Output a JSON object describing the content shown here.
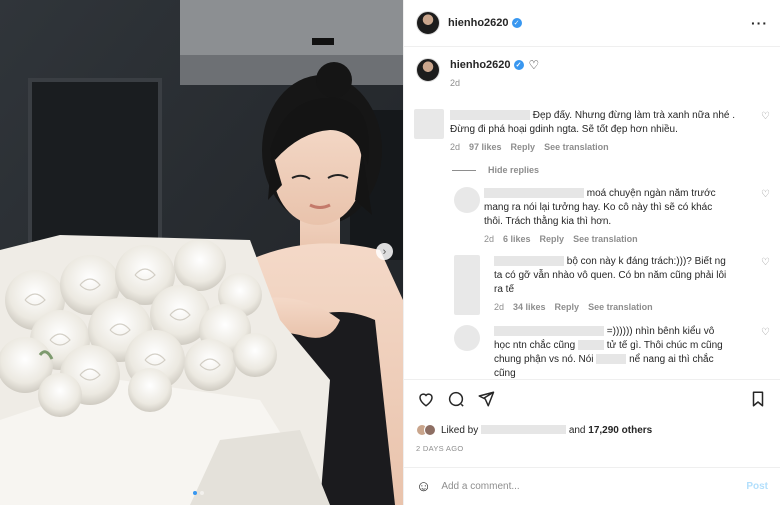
{
  "post": {
    "username": "hienho2620",
    "verified_icon": "verified-badge-icon",
    "more_icon": "more-options-icon"
  },
  "caption": {
    "username": "hienho2620",
    "time": "2d"
  },
  "comments": [
    {
      "text": "Đẹp đấy. Nhưng đừng làm trà xanh nữa nhé . Đừng đi phá hoại gdinh ngta. Sẽ tốt đẹp hơn nhiều.",
      "time": "2d",
      "likes": "97 likes",
      "reply": "Reply",
      "translate": "See translation"
    }
  ],
  "hide_replies": "Hide replies",
  "replies": [
    {
      "text_a": "moá chuyện ngàn năm trước",
      "text_b": "mang ra nói lại tưởng hay. Ko cô này thì sẽ có khác thôi. Trách thằng kia thì hơn.",
      "time": "2d",
      "likes": "6 likes",
      "reply": "Reply",
      "translate": "See translation"
    },
    {
      "text_a": "bộ con này k đáng trách:)))? Biết",
      "text_b": "ng ta có gỡ vẫn nhào vô quen. Có bn năm cũng phải lôi ra tế",
      "time": "2d",
      "likes": "34 likes",
      "reply": "Reply",
      "translate": "See translation"
    },
    {
      "text_a": "=)))))) nhìn bênh kiểu vô",
      "text_b": "học ntn chắc cũng",
      "text_c": "tử tế gì. Thôi chúc m cũng",
      "text_d": "chung phận vs nó. Nói",
      "text_e": "nể nang ai thì chắc cũng"
    }
  ],
  "liked_by": {
    "prefix": "Liked by",
    "mid": "and",
    "count": "17,290 others"
  },
  "date": "2 DAYS AGO",
  "add_comment": {
    "placeholder": "Add a comment...",
    "post_label": "Post"
  },
  "colors": {
    "accent": "#3897f0",
    "muted": "#8e8e8e",
    "post_disabled": "#b2dffc"
  }
}
